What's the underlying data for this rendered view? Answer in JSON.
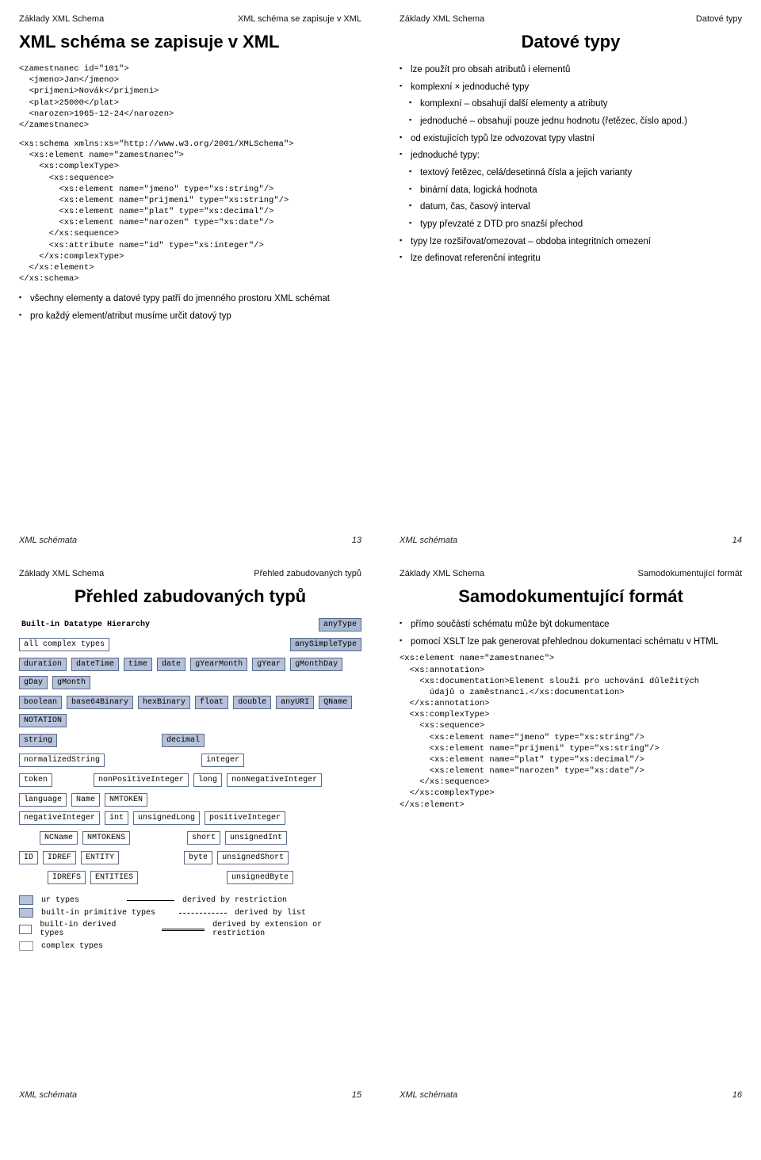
{
  "common": {
    "footer_label": "XML schémata",
    "breadcrumb_left": "Základy XML Schema"
  },
  "slide_a": {
    "breadcrumb_right": "XML schéma se zapisuje v XML",
    "title": "XML schéma se zapisuje v XML",
    "code1": "<zamestnanec id=\"101\">\n  <jmeno>Jan</jmeno>\n  <prijmeni>Novák</prijmeni>\n  <plat>25000</plat>\n  <narozen>1965-12-24</narozen>\n</zamestnanec>",
    "code2": "<xs:schema xmlns:xs=\"http://www.w3.org/2001/XMLSchema\">\n  <xs:element name=\"zamestnanec\">\n    <xs:complexType>\n      <xs:sequence>\n        <xs:element name=\"jmeno\" type=\"xs:string\"/>\n        <xs:element name=\"prijmeni\" type=\"xs:string\"/>\n        <xs:element name=\"plat\" type=\"xs:decimal\"/>\n        <xs:element name=\"narozen\" type=\"xs:date\"/>\n      </xs:sequence>\n      <xs:attribute name=\"id\" type=\"xs:integer\"/>\n    </xs:complexType>\n  </xs:element>\n</xs:schema>",
    "bullets": [
      "všechny elementy a datové typy patří do jmenného prostoru XML schémat",
      "pro každý element/atribut musíme určit datový typ"
    ],
    "page_no": "13"
  },
  "slide_b": {
    "breadcrumb_right": "Datové typy",
    "title": "Datové typy",
    "bullets_top": [
      "lze použít pro obsah atributů i elementů",
      "komplexní × jednoduché typy"
    ],
    "bullets_sub1": [
      "komplexní – obsahují další elementy a atributy",
      "jednoduché – obsahují pouze jednu hodnotu (řetězec, číslo apod.)"
    ],
    "bullets_mid": [
      "od existujících typů lze odvozovat typy vlastní",
      "jednoduché typy:"
    ],
    "bullets_sub2": [
      "textový řetězec, celá/desetinná čísla a jejich varianty",
      "binární data, logická hodnota",
      "datum, čas, časový interval",
      "typy převzaté z DTD pro snazší přechod"
    ],
    "bullets_bottom": [
      "typy lze rozšiřovat/omezovat – obdoba integritních omezení",
      "lze definovat referenční integritu"
    ],
    "page_no": "14"
  },
  "slide_c": {
    "breadcrumb_right": "Přehled zabudovaných typů",
    "title": "Přehled zabudovaných typů",
    "diagram": {
      "heading": "Built-in Datatype Hierarchy",
      "root": "anyType",
      "all_complex": "all complex types",
      "simple_root": "anySimpleType",
      "row1": [
        "duration",
        "dateTime",
        "time",
        "date",
        "gYearMonth",
        "gYear",
        "gMonthDay",
        "gDay",
        "gMonth"
      ],
      "row2": [
        "boolean",
        "base64Binary",
        "hexBinary",
        "float",
        "double",
        "anyURI",
        "QName",
        "NOTATION"
      ],
      "string_chain": [
        "string",
        "normalizedString",
        "token"
      ],
      "decimal_chain": [
        "decimal",
        "integer"
      ],
      "integer_row": [
        "nonPositiveInteger",
        "long",
        "nonNegativeInteger"
      ],
      "token_row": [
        "language",
        "Name",
        "NMTOKEN"
      ],
      "neg_row": [
        "negativeInteger",
        "int",
        "unsignedLong",
        "positiveInteger"
      ],
      "name_row": [
        "NCName",
        "NMTOKENS"
      ],
      "short_row": [
        "short",
        "unsignedInt"
      ],
      "id_row": [
        "ID",
        "IDREF",
        "ENTITY"
      ],
      "byte_row": [
        "byte",
        "unsignedShort"
      ],
      "idref_row": [
        "IDREFS",
        "ENTITIES"
      ],
      "ubyte_row": [
        "unsignedByte"
      ],
      "legend": {
        "ur": "ur types",
        "primitive": "built-in primitive types",
        "derived": "built-in derived types",
        "complex": "complex types",
        "restr": "derived by restriction",
        "list": "derived by list",
        "ext": "derived by extension or restriction"
      }
    },
    "page_no": "15"
  },
  "slide_d": {
    "breadcrumb_right": "Samodokumentující formát",
    "title": "Samodokumentující formát",
    "bullets": [
      "přímo součástí schématu může být dokumentace",
      "pomocí XSLT lze pak generovat přehlednou dokumentaci schématu v HTML"
    ],
    "code": "<xs:element name=\"zamestnanec\">\n  <xs:annotation>\n    <xs:documentation>Element slouží pro uchování důležitých\n      údajů o zaměstnanci.</xs:documentation>\n  </xs:annotation>\n  <xs:complexType>\n    <xs:sequence>\n      <xs:element name=\"jmeno\" type=\"xs:string\"/>\n      <xs:element name=\"prijmeni\" type=\"xs:string\"/>\n      <xs:element name=\"plat\" type=\"xs:decimal\"/>\n      <xs:element name=\"narozen\" type=\"xs:date\"/>\n    </xs:sequence>\n  </xs:complexType>\n</xs:element>",
    "page_no": "16"
  }
}
